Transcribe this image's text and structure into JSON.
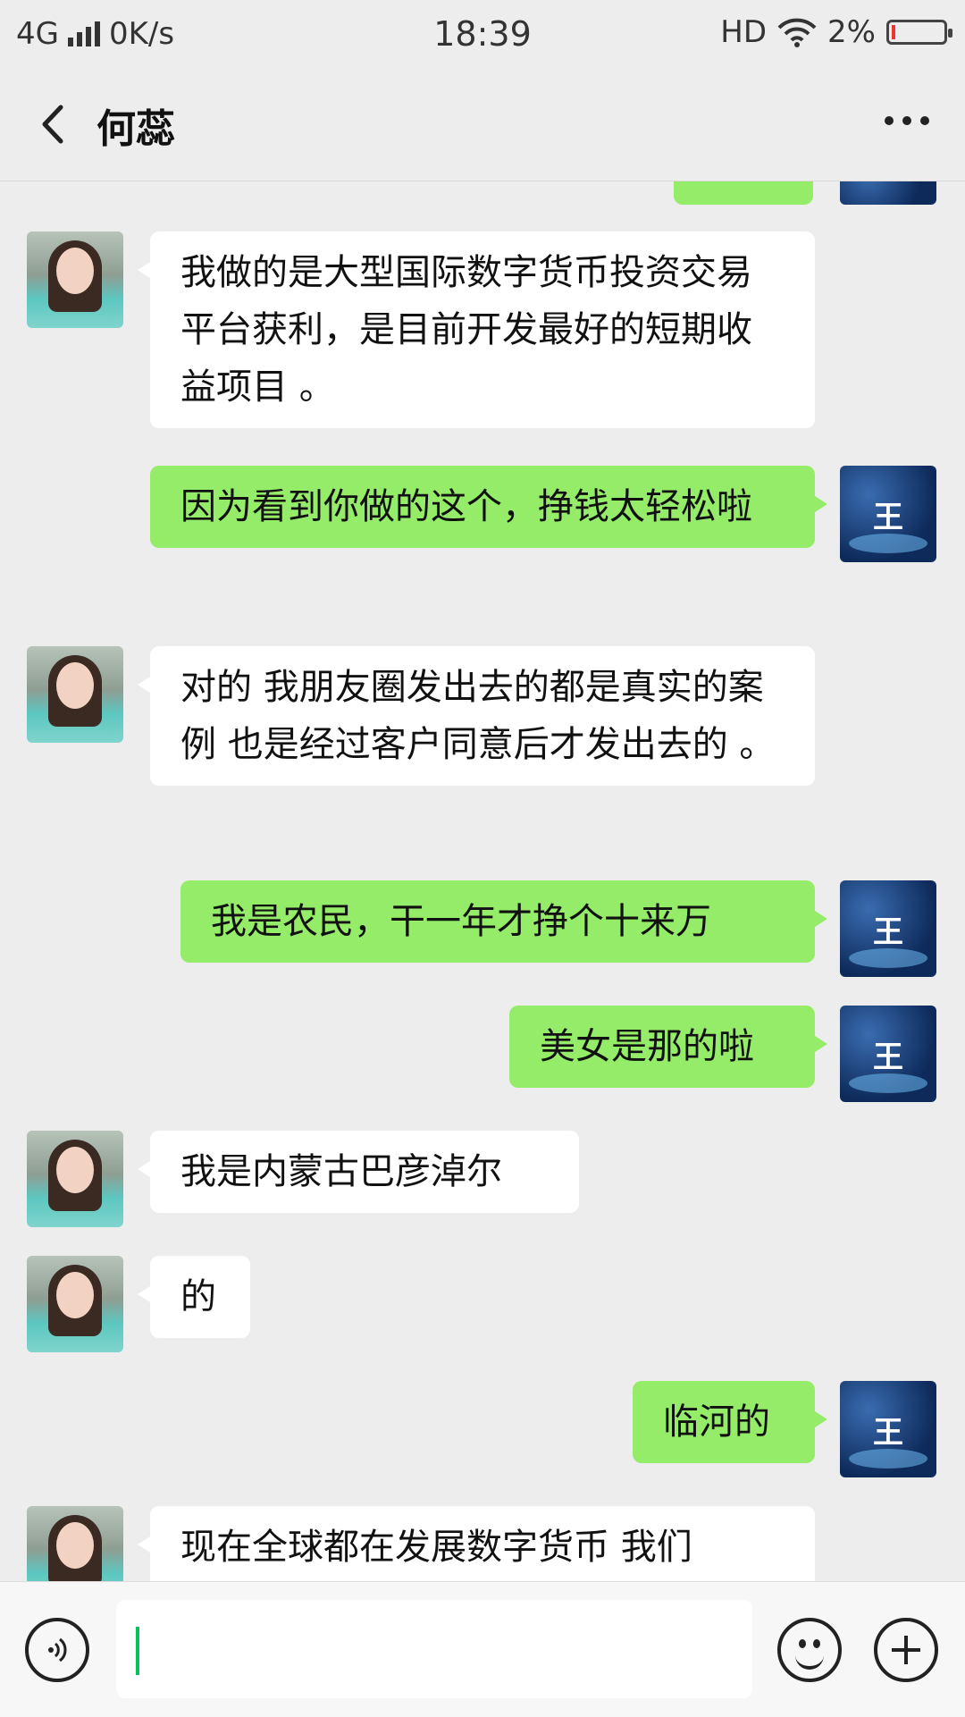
{
  "status_bar": {
    "network": "4G",
    "speed": "0K/s",
    "time": "18:39",
    "hd": "HD",
    "battery": "2%"
  },
  "header": {
    "title": "何蕊"
  },
  "avatars": {
    "her_icon": "woman-avatar",
    "me_text": "王"
  },
  "messages": [
    {
      "side": "left",
      "text": "我做的是大型国际数字货币投资交易平台获利，是目前开发最好的短期收益项目 。"
    },
    {
      "side": "right",
      "text": "因为看到你做的这个，挣钱太轻松啦"
    },
    {
      "side": "left",
      "text": "对的 我朋友圈发出去的都是真实的案例 也是经过客户同意后才发出去的 。"
    },
    {
      "side": "right",
      "text": "我是农民，干一年才挣个十来万"
    },
    {
      "side": "right",
      "text": "美女是那的啦"
    },
    {
      "side": "left",
      "text": "我是内蒙古巴彦淖尔"
    },
    {
      "side": "left",
      "text": "的"
    },
    {
      "side": "right",
      "text": "临河的"
    },
    {
      "side": "left",
      "text": "现在全球都在发展数字货币 我们"
    }
  ],
  "input_bar": {
    "voice_icon": "voice-icon",
    "emoji_icon": "emoji-icon",
    "plus_icon": "plus-icon",
    "text_value": ""
  },
  "colors": {
    "background": "#ededed",
    "bubble_mine": "#95ec69",
    "bubble_theirs": "#ffffff",
    "caret": "#07c160"
  }
}
